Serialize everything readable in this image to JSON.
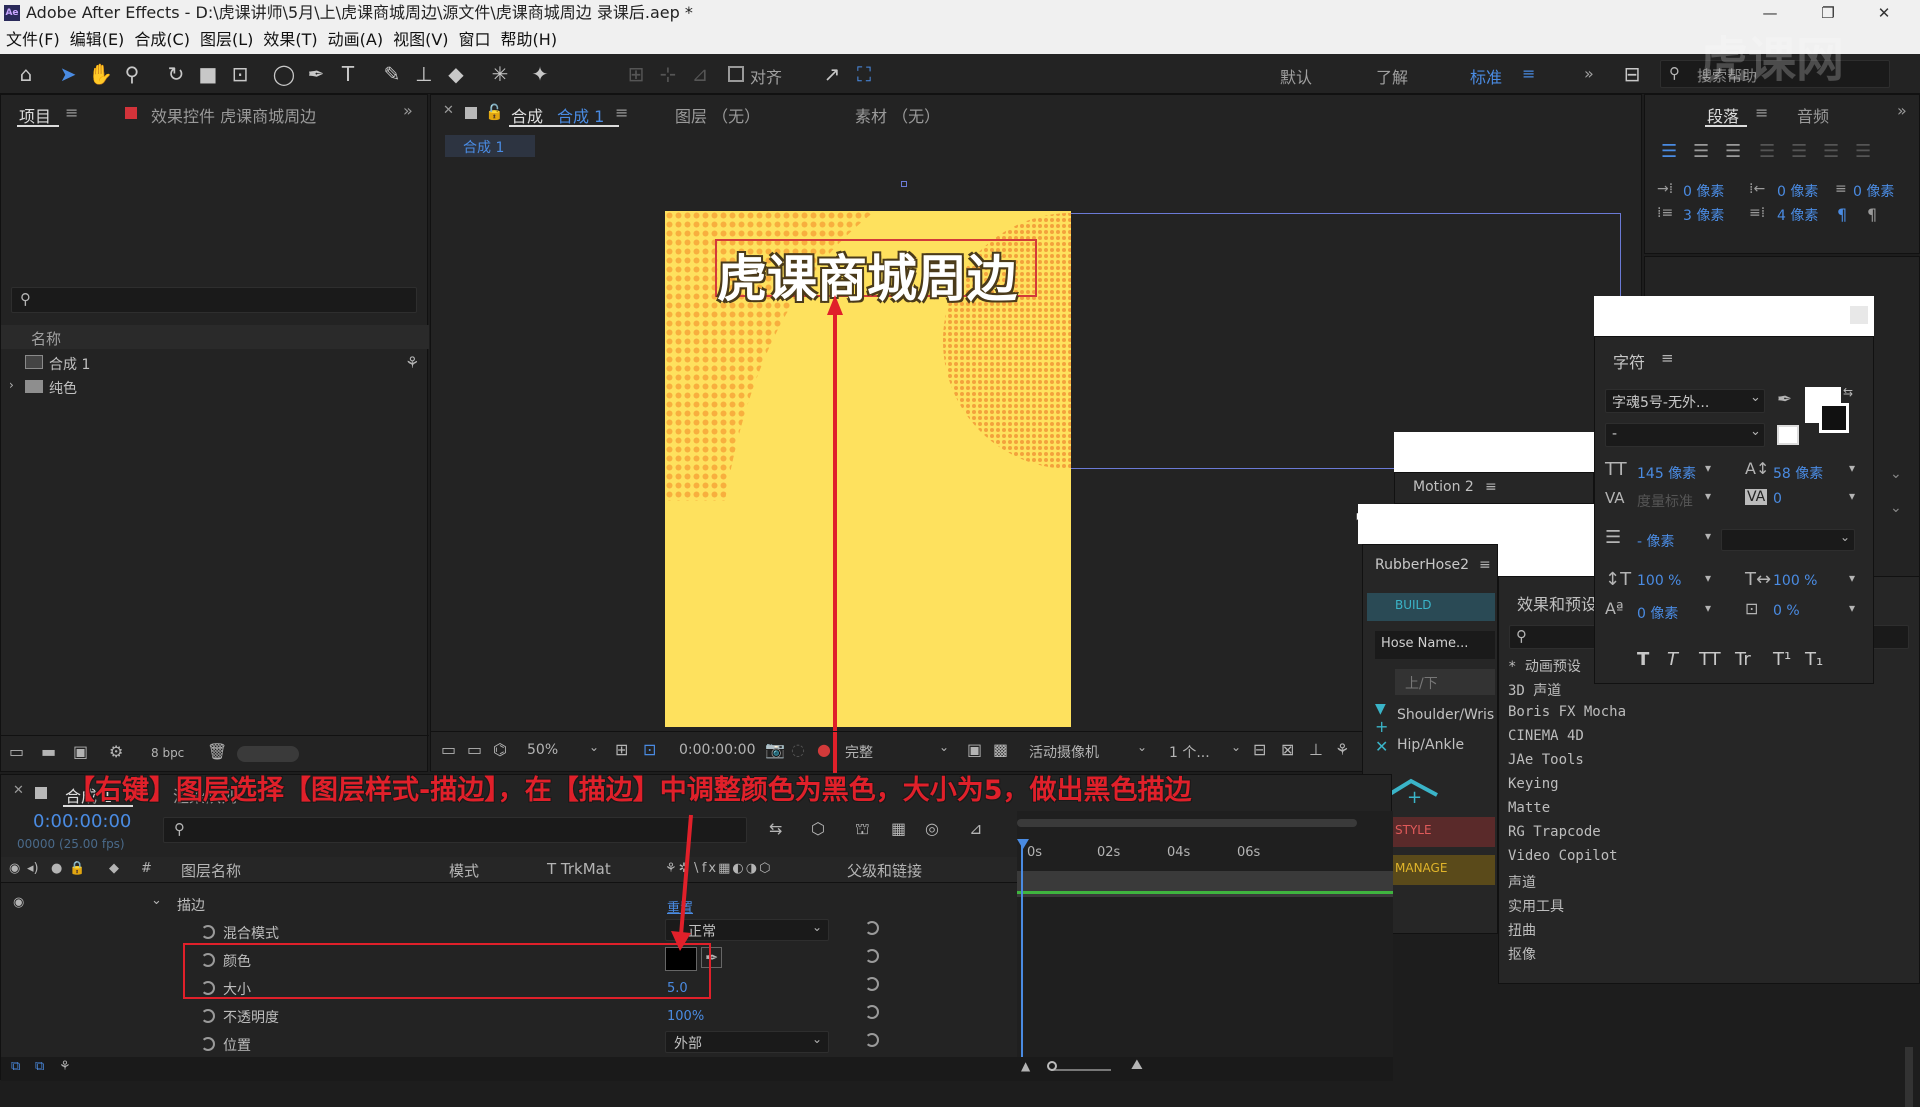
{
  "window": {
    "title": "Adobe After Effects - D:\\虎课讲师\\5月\\上\\虎课商城周边\\源文件\\虎课商城周边 录课后.aep *",
    "app_icon": "Ae"
  },
  "menu": [
    "文件(F)",
    "编辑(E)",
    "合成(C)",
    "图层(L)",
    "效果(T)",
    "动画(A)",
    "视图(V)",
    "窗口",
    "帮助(H)"
  ],
  "toolbar": {
    "align_label": "对齐",
    "workspaces": [
      "默认",
      "了解",
      "标准"
    ],
    "search_placeholder": "搜索帮助"
  },
  "project_panel": {
    "tab_project": "项目",
    "tab_effects": "效果控件 虎课商城周边",
    "column_name": "名称",
    "items": [
      "合成 1",
      "纯色"
    ],
    "bpc": "8 bpc"
  },
  "comp_panel": {
    "tab_comp": "合成",
    "tab_comp_name": "合成 1",
    "tab_layer": "图层 （无）",
    "tab_footage": "素材 （无）",
    "breadcrumb": "合成 1",
    "canvas_text": "虎课商城周边",
    "zoom": "50%",
    "timecode": "0:00:00:00",
    "quality": "完整",
    "camera": "活动摄像机",
    "views": "1 个..."
  },
  "paragraph_panel": {
    "tab_paragraph": "段落",
    "tab_audio": "音频",
    "indent_left": "0 像素",
    "indent_right": "0 像素",
    "indent_first": "0 像素",
    "space_before": "3 像素",
    "space_after": "4 像素"
  },
  "character_panel": {
    "title": "字符",
    "font": "字魂5号-无外...",
    "style": "-",
    "size": "145 像素",
    "leading": "58 像素",
    "kerning": "度量标准",
    "tracking": "0",
    "stroke": "- 像素",
    "vscale": "100 %",
    "hscale": "100 %",
    "baseline": "0 像素",
    "tsume": "0 %",
    "styles": [
      "T",
      "T",
      "TT",
      "Tr",
      "T¹",
      "T₁"
    ]
  },
  "motion_panel": {
    "title": "Motion 2"
  },
  "rubberhose_panel": {
    "title": "RubberHose2",
    "build": "BUILD",
    "hose_name": "Hose Name...",
    "updown": "上/下",
    "shoulder": "Shoulder/Wris",
    "hip": "Hip/Ankle",
    "style": "STYLE",
    "manage": "MANAGE"
  },
  "effects_panel": {
    "title": "效果和预设",
    "items": [
      "* 动画预设",
      "3D 声道",
      "Boris FX Mocha",
      "CINEMA 4D",
      "JAe Tools",
      "Keying",
      "Matte",
      "RG Trapcode",
      "Video Copilot",
      "声道",
      "实用工具",
      "扭曲",
      "抠像"
    ]
  },
  "timeline": {
    "tab_comp": "合成 1",
    "tab_render": "渲染队列",
    "timecode": "0:00:00:00",
    "frame_info": "00000 (25.00 fps)",
    "col_layer_name": "图层名称",
    "col_mode": "模式",
    "col_trkmat": "T  TrkMat",
    "col_parent": "父级和链接",
    "ruler": [
      "0s",
      "02s",
      "04s",
      "06s"
    ],
    "group": "描边",
    "reset": "重置",
    "props": [
      {
        "name": "混合模式",
        "value": "正常"
      },
      {
        "name": "颜色",
        "value": ""
      },
      {
        "name": "大小",
        "value": "5.0"
      },
      {
        "name": "不透明度",
        "value": "100%"
      },
      {
        "name": "位置",
        "value": "外部"
      }
    ]
  },
  "caption": "【右键】图层选择【图层样式-描边】，在【描边】中调整颜色为黑色，大小为5，做出黑色描边",
  "colors": {
    "accent": "#4a8be2",
    "annotation": "#e0202a",
    "canvas": "#fee15e",
    "canvas_dots": "#f7a93a"
  }
}
